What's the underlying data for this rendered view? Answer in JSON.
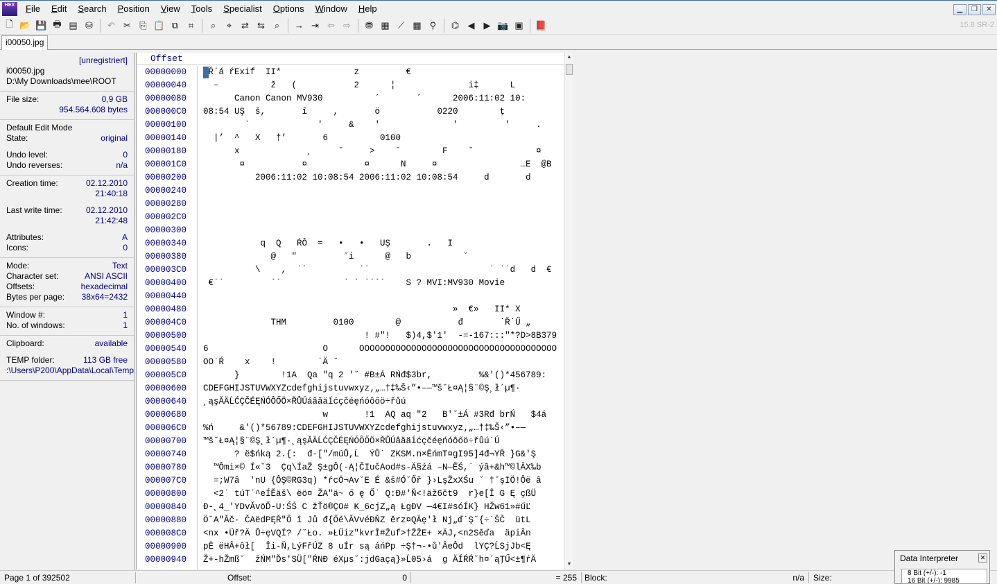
{
  "menu": [
    "File",
    "Edit",
    "Search",
    "Position",
    "View",
    "Tools",
    "Specialist",
    "Options",
    "Window",
    "Help"
  ],
  "app_logo_text": "HEX",
  "window_buttons": {
    "minimize": "▁",
    "restore": "❐",
    "close": "✕"
  },
  "version": "15.8 SR-2",
  "tab": "i00050.jpg",
  "info": {
    "unregistered": "[unregistriert]",
    "filename": "i00050.jpg",
    "path": "D:\\My Downloads\\mee\\ROOT",
    "file_size_label": "File size:",
    "file_size_gb": "0,9 GB",
    "file_size_bytes": "954.564.608 bytes",
    "edit_mode": "Default Edit Mode",
    "state_label": "State:",
    "state": "original",
    "undo_level_label": "Undo level:",
    "undo_level": "0",
    "undo_reverses_label": "Undo reverses:",
    "undo_reverses": "n/a",
    "creation_label": "Creation time:",
    "creation_date": "02.12.2010",
    "creation_time": "21:40:18",
    "last_write_label": "Last write time:",
    "last_write_date": "02.12.2010",
    "last_write_time": "21:42:48",
    "attributes_label": "Attributes:",
    "attributes": "A",
    "icons_label": "Icons:",
    "icons": "0",
    "mode_label": "Mode:",
    "mode": "Text",
    "charset_label": "Character set:",
    "charset": "ANSI ASCII",
    "offsets_label": "Offsets:",
    "offsets": "hexadecimal",
    "bpp_label": "Bytes per page:",
    "bpp": "38x64=2432",
    "window_num_label": "Window #:",
    "window_num": "1",
    "num_windows_label": "No. of windows:",
    "num_windows": "1",
    "clipboard_label": "Clipboard:",
    "clipboard": "available",
    "temp_label": "TEMP folder:",
    "temp_free": "113 GB free",
    "temp_path": ":\\Users\\P200\\AppData\\Local\\Temp"
  },
  "hex": {
    "offset_header": "Offset",
    "rows": [
      {
        "offset": "00000000",
        "text": " Ř´á ŕExif  II*              z         €"
      },
      {
        "offset": "00000040",
        "text": "  –          ž   (           2      ¦              i‡      L"
      },
      {
        "offset": "00000080",
        "text": "      Canon Canon MV930          ´       ´      2006:11:02 10:"
      },
      {
        "offset": "000000C0",
        "text": "08:54 UŞ  š,       î     ,       ö           0220        ţ"
      },
      {
        "offset": "00000100",
        "text": "        `             '     &    '              '         '     ."
      },
      {
        "offset": "00000140",
        "text": "  |’  ^   X   †’       6          0100"
      },
      {
        "offset": "00000180",
        "text": "      x             ¸     ˘     >    ˘        F    ˘            ¤"
      },
      {
        "offset": "000001C0",
        "text": "       ¤           ¤           ¤      N     ¤                …E  @B"
      },
      {
        "offset": "00000200",
        "text": "          2006:11:02 10:08:54 2006:11:02 10:08:54     d       d"
      },
      {
        "offset": "00000240",
        "text": ""
      },
      {
        "offset": "00000280",
        "text": ""
      },
      {
        "offset": "000002C0",
        "text": ""
      },
      {
        "offset": "00000300",
        "text": ""
      },
      {
        "offset": "00000340",
        "text": "           q  Q   ŔÔ  =   •   •   UŞ       .   I"
      },
      {
        "offset": "00000380",
        "text": "             @   \"         ˘i      @   b          ˘"
      },
      {
        "offset": "000003C0",
        "text": "          \\    ,  ˙˙          ˙˙                       ˙ ˙˙d   d  €"
      },
      {
        "offset": "00000400",
        "text": " €˙˙         ˙˙            ˙ ˙ ˙˙˙˙    S ? MVI:MV930 Movie"
      },
      {
        "offset": "00000440",
        "text": ""
      },
      {
        "offset": "00000480",
        "text": "                                                »  €»   II* X"
      },
      {
        "offset": "000004C0",
        "text": "             THM         0100        @           đ       ˙Ř˙Ű „"
      },
      {
        "offset": "00000500",
        "text": "                               ! #\"!   $)4,$'1'  -=-167:::\"*?D>8B379"
      },
      {
        "offset": "00000540",
        "text": "6                      O      OOOOOOOOOOOOOOOOOOOOOOOOOOOOOOOOOOOOOO"
      },
      {
        "offset": "00000580",
        "text": "OO˙Ŕ    x    !        ˙Ä ˘"
      },
      {
        "offset": "000005C0",
        "text": "      }        !1A  Qa \"q 2 '˘ #B±Á RŃđ$3br,         %&'()*456789:"
      },
      {
        "offset": "00000600",
        "text": "CDEFGHIJSTUVWXYZcdefghijstuvwxyz‚„…†‡‰Š‹”•–—™š˘Ł¤Ą¦§¨©Ş¸ł´µ¶·"
      },
      {
        "offset": "00000640",
        "text": "¸ąşĂÄĹĆÇČÉĘŃÓÔŐÖ×ŘŮÚáâăäĺćçčéęńóôőö÷řůú"
      },
      {
        "offset": "00000680",
        "text": "                       w       !1  AQ aq \"2   B'˘±Á #3Rđ brŃ   $4á"
      },
      {
        "offset": "000006C0",
        "text": "%ń     &'()*56789:CDEFGHIJSTUVWXYZcdefghijstuvwxyz‚„…†‡‰Š‹”•–—"
      },
      {
        "offset": "00000700",
        "text": "™š˘Ł¤Ą¦§¨©Ş¸ł´µ¶·¸ąşĂÄĹĆÇČÉĘŃÓÔŐÖ×ŘŮÚâăäĺćçčéęńóôőö÷řůú˙Ú"
      },
      {
        "offset": "00000740",
        "text": "      ? ë$ńką 2.{:  đ-[\"/müŮ,Ĺ  ÝŮ˙ ZKSM.n×ĔńmT¤gI95]4đ¬YŘ }G&'Ş"
      },
      {
        "offset": "00000780",
        "text": "  ™Ômi×© Í«˘3  Çq\\ÍaŽ Ş±gÔ(-Ą¦ČIučAod#s-Ä§źá –N—ĚŚ,˙ ýâ+&h™©lÂX‰b"
      },
      {
        "offset": "000007C0",
        "text": "  =;W7â  ′nU {ÔŞ©RG3q) *ŕcÖ¬Av˘E É &š#Ó˘Őř }›LşŽxXŚu ˘ †˘şIÖ!Ôë â"
      },
      {
        "offset": "00000800",
        "text": "  <2˙ túT´^eÍĚäš\\ ëö¤ ŽA\"ä~ ő ę Ő˙ Q:Đ#'Ň<!äž6čt9  r}e[Î G Ę çßÜ"
      },
      {
        "offset": "00000840",
        "text": "Đ-¸4_'YDvĂvöĎ-U:ŚŚ C žŤö®ÇO# K_6cjZ„ą ŁgĐV —4€I#sóÍK} HŽw61»#űĽ"
      },
      {
        "offset": "00000880",
        "text": "Ö˘A\"Ăč· ČAëdPĘŘ\"Ô î Jů đ{Őé\\ĂVvéĐŇZ ěrz¤QÄę'ł Nj„ď˙Ş˘{÷˙ŠČ  ütL"
      },
      {
        "offset": "000008C0",
        "text": "<nx •Üř?Ä Ů÷ęVQÍ? /˘Ło. »ŁŰiz\"kvrÎ#Žuf>†ŽŽE+ ×ÄJ,<n2Sěďa  äpiĂn"
      },
      {
        "offset": "00000900",
        "text": "pË ëHÂ+ôł[  Îi-Ň,LýFřÚZ 8 uÍr są áńPp ÷Ş†¬-•ů'ÂeÔd  lYÇ?ĹSjJb<Ę"
      },
      {
        "offset": "00000940",
        "text": "Ž+-hŽmß˘  žŃM\"Ďs'SÜ[\"ŔNĐ éXµs˘:jdGaçą}»Ĺ05›á  g ÄÍŔŔ˘h¤´ąŢŰ<±¶ŕÄ"
      }
    ]
  },
  "status": {
    "page": "Page 1 of 392502",
    "offset_label": "Offset:",
    "offset_value": "0",
    "value": "= 255",
    "block_label": "Block:",
    "block_value": "n/a",
    "size_label": "Size:"
  },
  "data_interpreter": {
    "title": "Data Interpreter",
    "close": "✕",
    "rows": [
      "8 Bit (+/-): -1",
      "16 Bit (+/-): 9985"
    ]
  }
}
